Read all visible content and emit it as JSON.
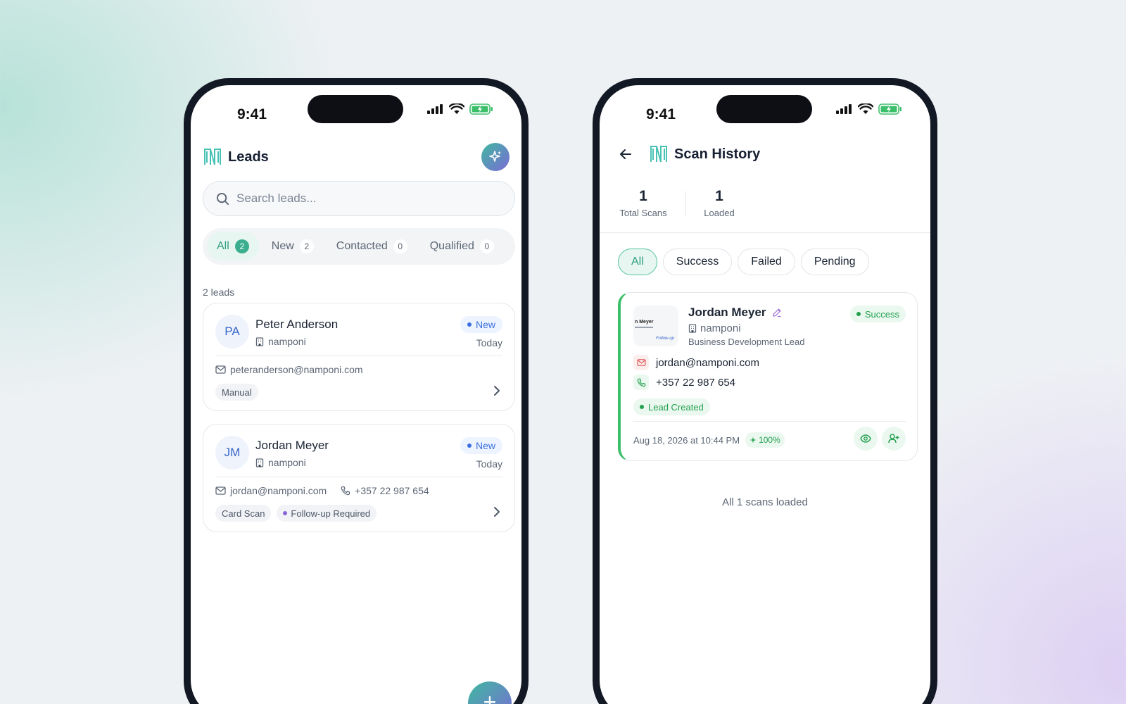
{
  "status_bar": {
    "time": "9:41"
  },
  "leads_screen": {
    "title": "Leads",
    "search": {
      "placeholder": "Search leads...",
      "value": ""
    },
    "tabs": [
      {
        "label": "All",
        "count": "2"
      },
      {
        "label": "New",
        "count": "2"
      },
      {
        "label": "Contacted",
        "count": "0"
      },
      {
        "label": "Qualified",
        "count": "0"
      }
    ],
    "count_label": "2 leads",
    "leads": [
      {
        "initials": "PA",
        "name": "Peter Anderson",
        "company": "namponi",
        "status": "New",
        "date": "Today",
        "email": "peteranderson@namponi.com",
        "phone": "",
        "tags": [
          "Manual"
        ]
      },
      {
        "initials": "JM",
        "name": "Jordan Meyer",
        "company": "namponi",
        "status": "New",
        "date": "Today",
        "email": "jordan@namponi.com",
        "phone": "+357 22 987 654",
        "tags": [
          "Card Scan",
          "Follow-up Required"
        ]
      }
    ],
    "fab_label": "+"
  },
  "scan_history_screen": {
    "title": "Scan History",
    "stats": [
      {
        "value": "1",
        "label": "Total Scans"
      },
      {
        "value": "1",
        "label": "Loaded"
      }
    ],
    "filters": [
      "All",
      "Success",
      "Failed",
      "Pending"
    ],
    "scan": {
      "thumb_name": "n Meyer",
      "thumb_sig": "Follow-up",
      "name": "Jordan Meyer",
      "company": "namponi",
      "role": "Business Development Lead",
      "status": "Success",
      "email": "jordan@namponi.com",
      "phone": "+357 22 987 654",
      "result": "Lead Created",
      "date": "Aug 18, 2026 at 10:44 PM",
      "confidence": "100%"
    },
    "footer": "All 1 scans loaded"
  },
  "colors": {
    "accent": "#3aae8e",
    "success": "#23a04e",
    "new_badge": "#3a6ee0",
    "purple": "#8a63d9"
  }
}
